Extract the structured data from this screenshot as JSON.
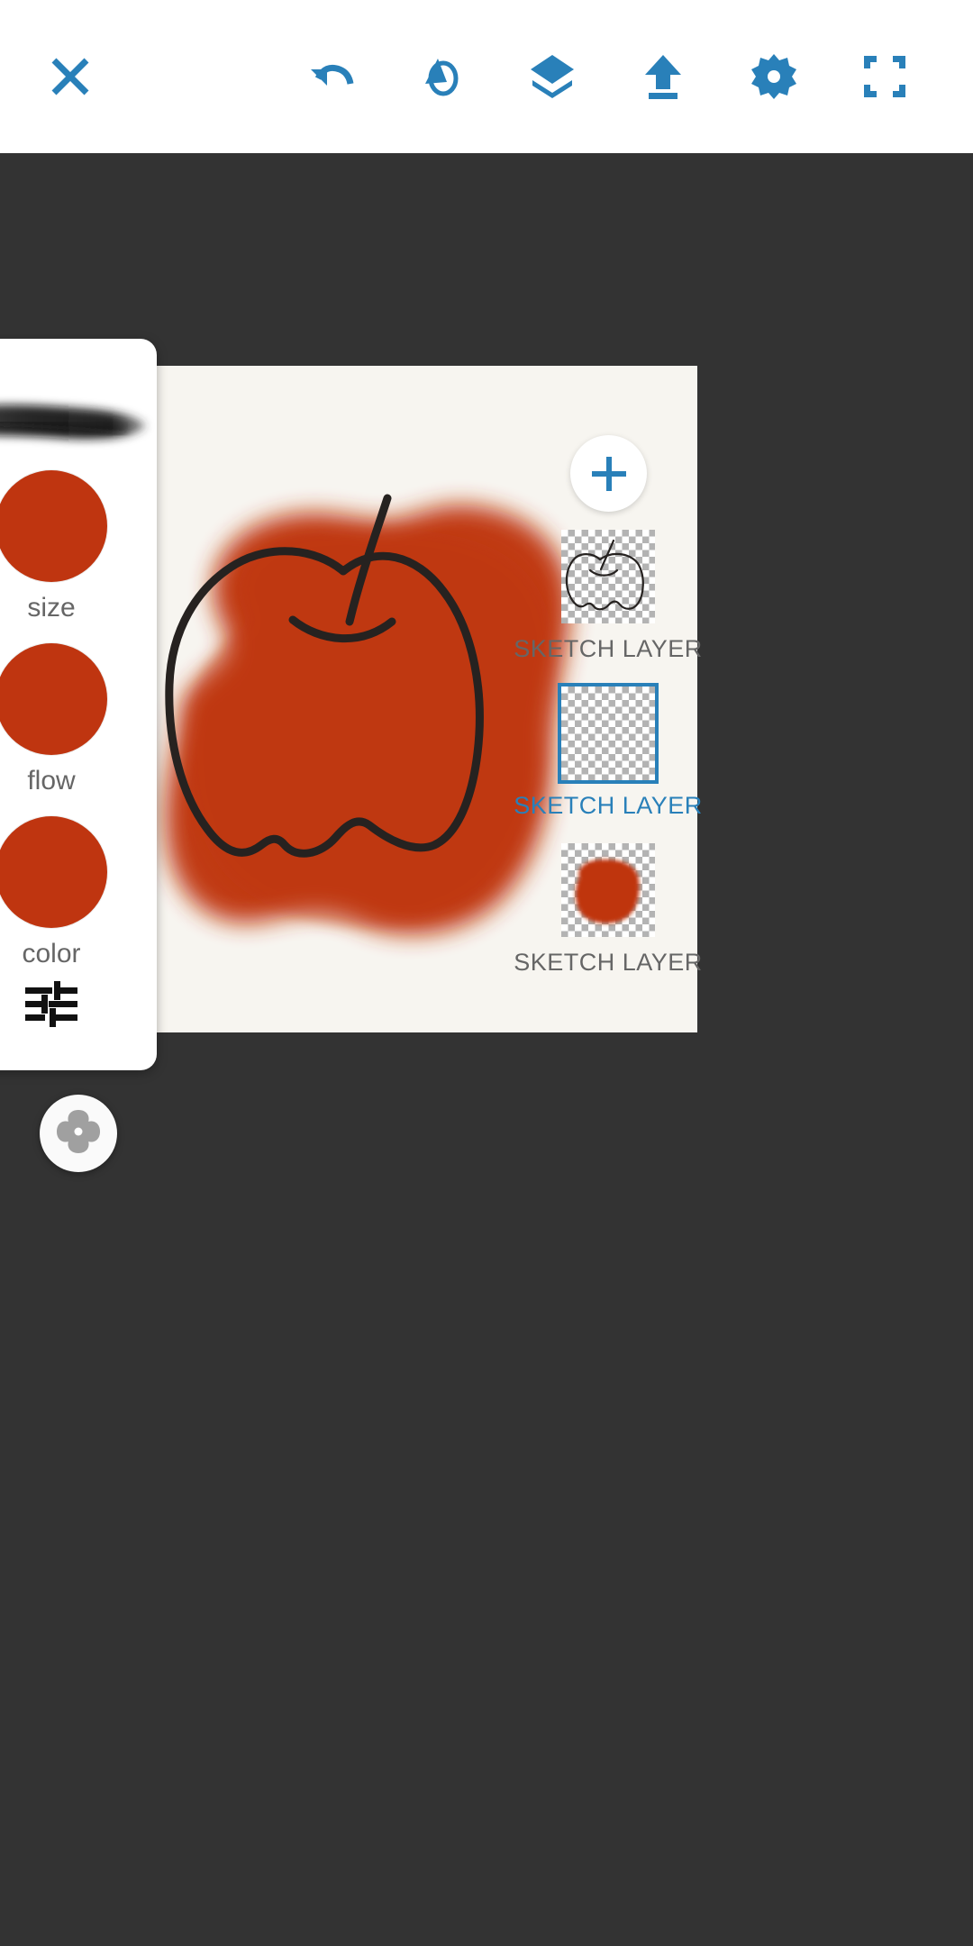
{
  "app": {
    "canvas_background": "#f7f5f0",
    "workspace_background": "#333333",
    "accent_color": "#2980b9",
    "brush_color": "#bf3510",
    "ink_color": "#262220"
  },
  "toolbar": {
    "close": {
      "label": "Close",
      "icon": "close-icon"
    },
    "actions": [
      {
        "name": "undo",
        "label": "Undo",
        "icon": "undo-icon"
      },
      {
        "name": "redo",
        "label": "Redo",
        "icon": "redo-icon"
      },
      {
        "name": "layers",
        "label": "Layers",
        "icon": "layers-icon"
      },
      {
        "name": "export",
        "label": "Export",
        "icon": "upload-icon"
      },
      {
        "name": "settings",
        "label": "Settings",
        "icon": "gear-icon"
      },
      {
        "name": "fullscreen",
        "label": "Fullscreen",
        "icon": "fullscreen-icon"
      }
    ]
  },
  "layers_panel": {
    "add_layer": {
      "label": "+",
      "icon": "plus-icon"
    },
    "items": [
      {
        "label": "SKETCH LAYER",
        "selected": false,
        "content": "apple-outline"
      },
      {
        "label": "SKETCH LAYER",
        "selected": true,
        "content": "empty"
      },
      {
        "label": "SKETCH LAYER",
        "selected": false,
        "content": "red-blob"
      }
    ]
  },
  "tool_panel": {
    "stroke_preview": "watercolor-stroke",
    "controls": [
      {
        "label": "size",
        "name": "size-control",
        "color": "#bf3510"
      },
      {
        "label": "flow",
        "name": "flow-control",
        "color": "#bf3510"
      },
      {
        "label": "color",
        "name": "color-control",
        "color": "#bf3510"
      }
    ],
    "tune": {
      "label": "Brush settings",
      "icon": "tune-icon"
    }
  },
  "brush_button": {
    "label": "Brush",
    "icon": "fan-brush-icon"
  }
}
